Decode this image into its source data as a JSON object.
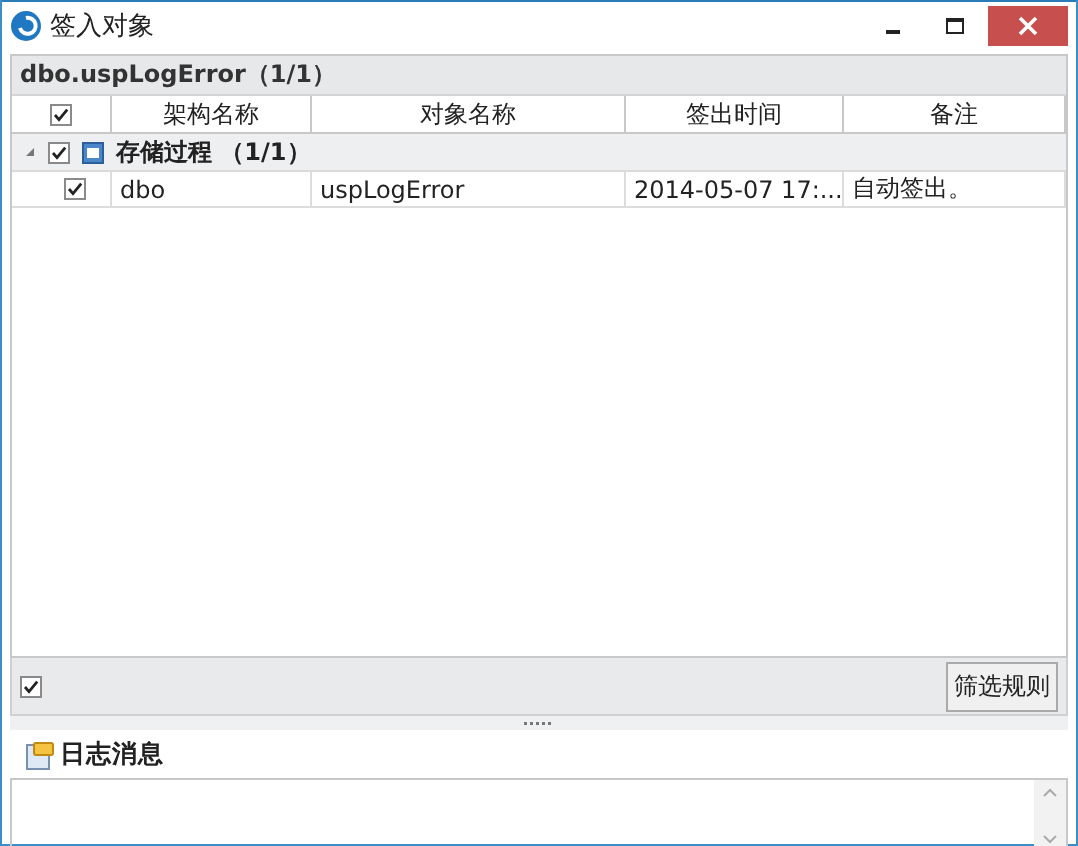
{
  "window": {
    "title": "签入对象"
  },
  "panel_title": "dbo.uspLogError（1/1）",
  "table": {
    "header_checked": true,
    "columns": [
      "架构名称",
      "对象名称",
      "签出时间",
      "备注"
    ],
    "groups": [
      {
        "label": "存储过程 （1/1）",
        "expanded": true,
        "checked": true,
        "rows": [
          {
            "checked": true,
            "cells": [
              "dbo",
              "uspLogError",
              "2014-05-07 17:...",
              "自动签出。"
            ]
          }
        ]
      }
    ]
  },
  "footer": {
    "checked": true,
    "button": "筛选规则"
  },
  "log": {
    "title": "日志消息"
  }
}
